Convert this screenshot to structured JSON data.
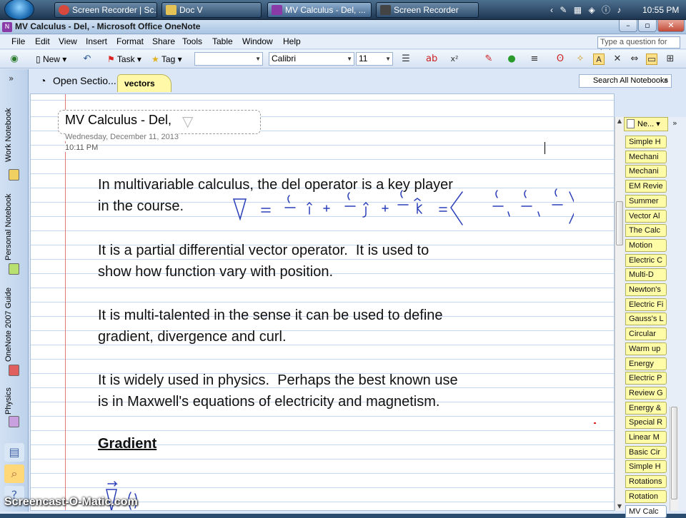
{
  "taskbar": {
    "tasks": [
      {
        "label": "Screen Recorder | Sc...",
        "icon": "chrome-icon",
        "color": "#d8493d"
      },
      {
        "label": "Doc V",
        "icon": "folder-icon",
        "color": "#e5c256"
      },
      {
        "label": "MV Calculus - Del, ...",
        "icon": "onenote-icon",
        "color": "#8a3aa6"
      },
      {
        "label": "Screen Recorder",
        "icon": "recorder-icon",
        "color": "#444444"
      }
    ],
    "clock": "10:55 PM"
  },
  "window": {
    "title": "MV Calculus - Del,  - Microsoft Office OneNote",
    "controls": [
      "–",
      "▫",
      "✕"
    ]
  },
  "menu": {
    "items": [
      "File",
      "Edit",
      "View",
      "Insert",
      "Format",
      "Share",
      "Tools",
      "Table",
      "Window",
      "Help"
    ],
    "question_placeholder": "Type a question for help"
  },
  "toolbar": {
    "new_label": "New",
    "task_label": "Task",
    "tag_label": "Tag",
    "font": "Calibri",
    "size": "11",
    "superscript": "x²"
  },
  "notebooks": [
    {
      "name": "Work Notebook",
      "color": "#f0d060"
    },
    {
      "name": "Personal Notebook",
      "color": "#b8e070"
    },
    {
      "name": "OneNote 2007 Guide",
      "color": "#e06060"
    },
    {
      "name": "Physics",
      "color": "#c8a0e0"
    }
  ],
  "section": {
    "open_label": "Open Sectio...",
    "tab_label": "vectors",
    "search_placeholder": "Search All Notebooks"
  },
  "page": {
    "title": "MV Calculus - Del,",
    "nabla": "▽",
    "date": "Wednesday, December  11, 2013",
    "time": "10:11 PM",
    "paragraphs": [
      "In multivariable calculus, the del operator is a key player\nin the course.",
      "It is a partial differential vector operator.  It is used to\nshow how function vary with position.",
      "It is multi-talented in the sense it can be used to define\ngradient, divergence and curl.",
      "It is widely used in physics.  Perhaps the best known use\nis in Maxwell's equations of electricity and magnetism."
    ],
    "heading": "Gradient"
  },
  "pages_panel": {
    "new_label": "Ne...",
    "items": [
      "Simple H",
      "Mechani",
      "Mechani",
      "EM Revie",
      "Summer",
      "Vector Al",
      "The Calc",
      "Motion",
      "Electric C",
      "Multi-D",
      "Newton's",
      "Electric Fi",
      "Gauss's L",
      "Circular",
      "Warm up",
      "Energy",
      "Electric P",
      "Review G",
      "Energy &",
      "Special R",
      "Linear M",
      "Basic Cir",
      "Simple H",
      "Rotations",
      "Rotation",
      "MV Calc"
    ],
    "selected": 25
  },
  "watermark": "Screencast-O-Matic.com"
}
